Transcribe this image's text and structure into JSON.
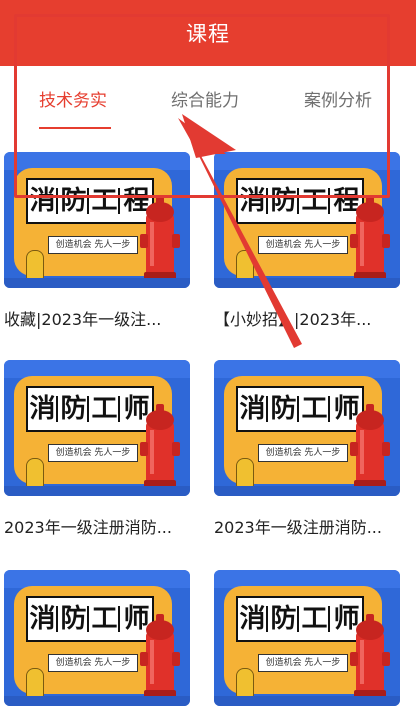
{
  "header": {
    "title": "课程"
  },
  "tabs": [
    {
      "label": "技术务实",
      "active": true
    },
    {
      "label": "综合能力",
      "active": false
    },
    {
      "label": "案例分析",
      "active": false
    }
  ],
  "thumbnail": {
    "chars": [
      "消",
      "防",
      "工",
      "程",
      "师"
    ],
    "slogan": "创造机会 先人一步"
  },
  "courses": [
    {
      "title": "收藏|2023年一级注..."
    },
    {
      "title": "【小妙招】|2023年..."
    },
    {
      "title": "2023年一级注册消防..."
    },
    {
      "title": "2023年一级注册消防..."
    },
    {
      "title": ""
    },
    {
      "title": ""
    }
  ],
  "colors": {
    "accent": "#e63e2f",
    "thumb_blue": "#2f68d8",
    "thumb_yellow": "#f5b236"
  }
}
